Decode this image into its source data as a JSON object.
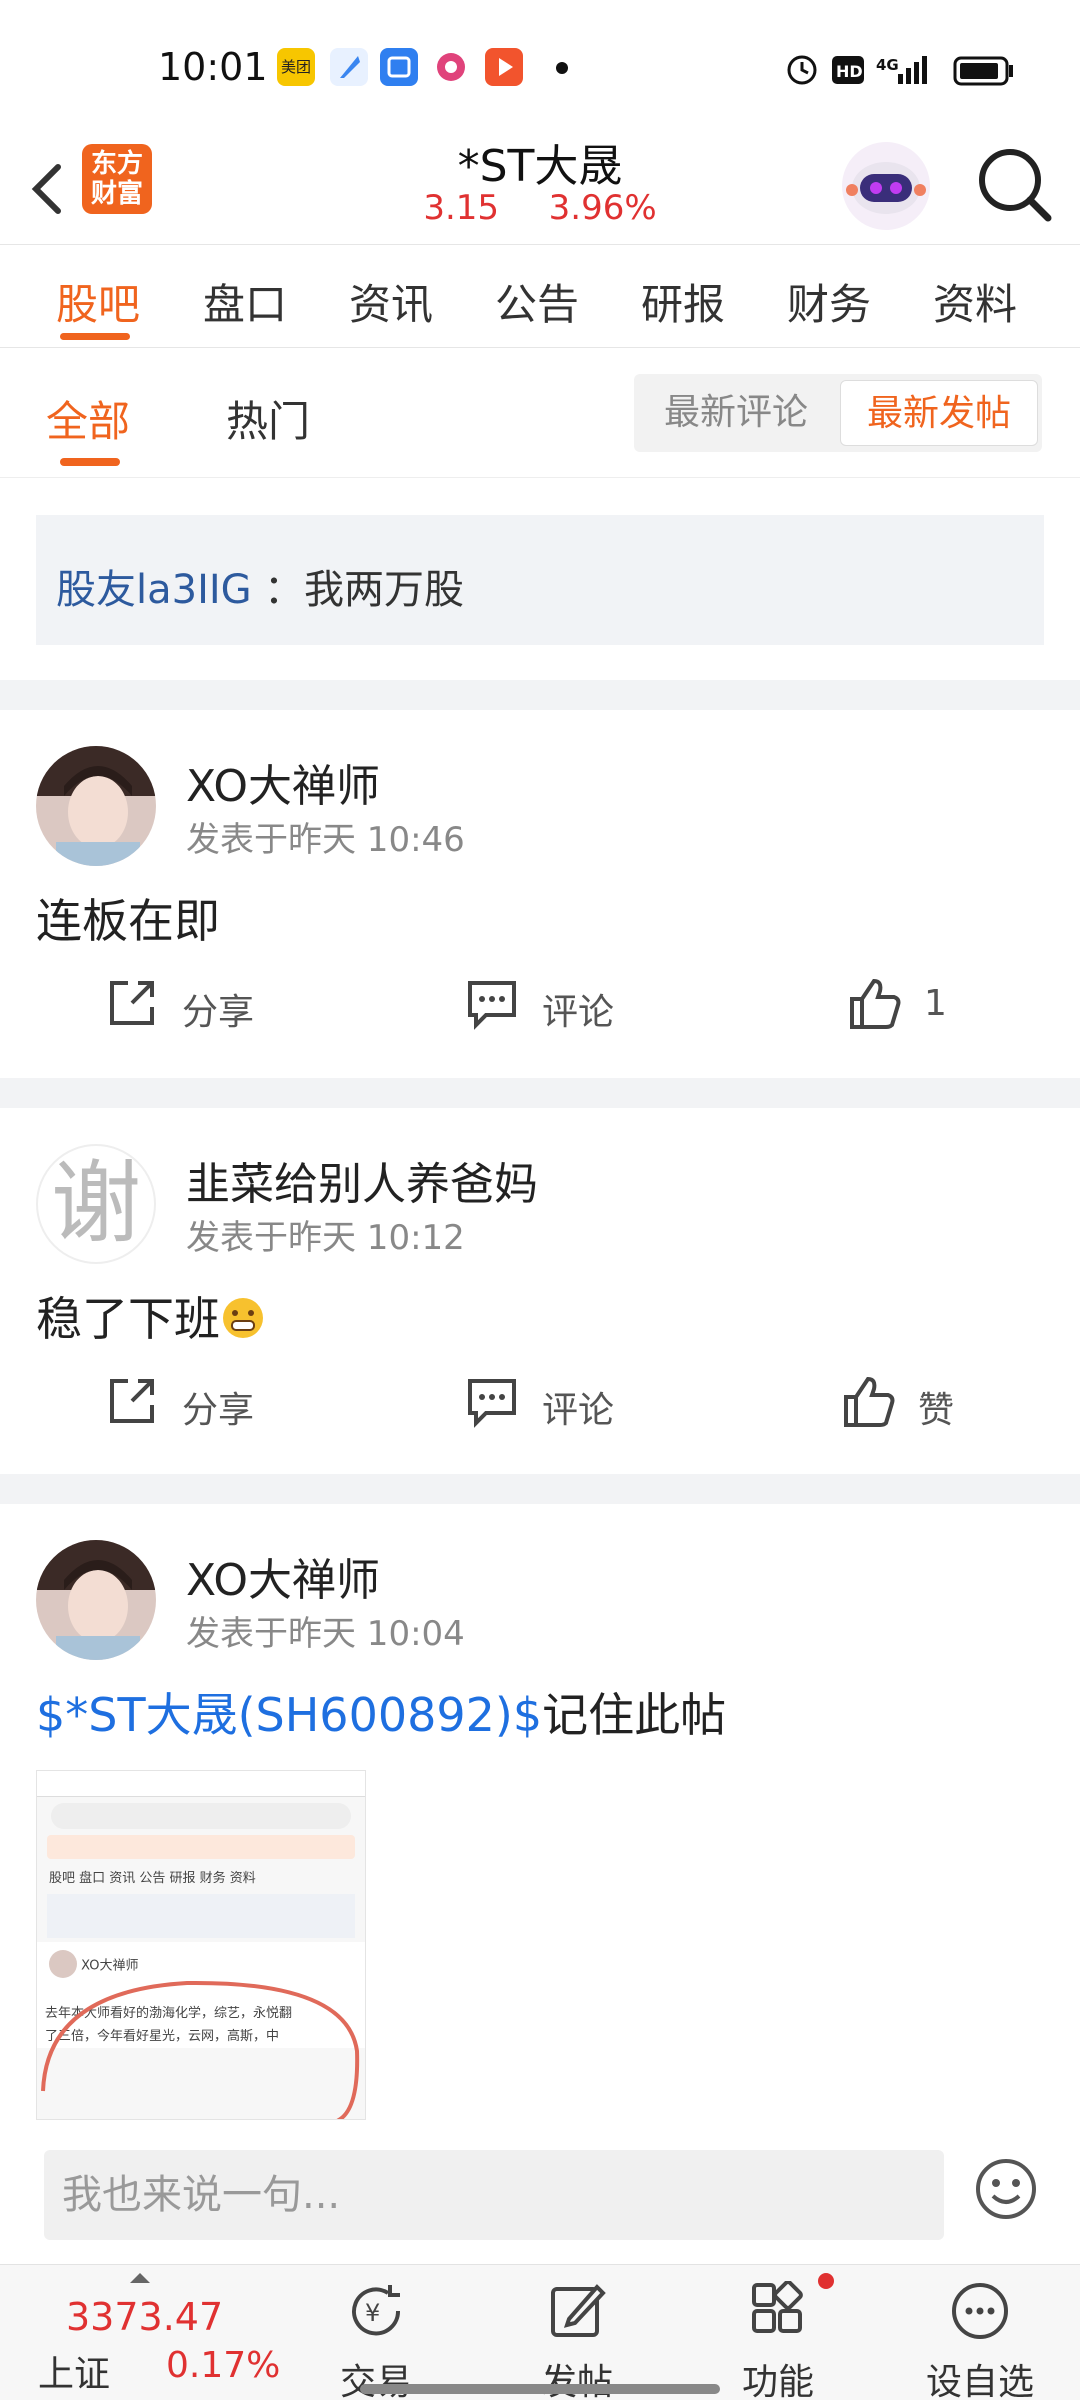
{
  "status_bar": {
    "time": "10:01",
    "app_badges": [
      "美团",
      "",
      "",
      "",
      ""
    ]
  },
  "header": {
    "back_icon": "chevron-left-icon",
    "logo_line1": "东方",
    "logo_line2": "财富",
    "stock_title": "*ST大晟",
    "price": "3.15",
    "change_pct": "3.96%",
    "robot_icon": "robot-avatar-icon",
    "search_icon": "search-icon"
  },
  "tabs": [
    "股吧",
    "盘口",
    "资讯",
    "公告",
    "研报",
    "财务",
    "资料"
  ],
  "active_tab": "股吧",
  "subtabs": [
    "全部",
    "热门"
  ],
  "sort_options": [
    "最新评论",
    "最新发帖"
  ],
  "notice": {
    "user": "股友la3IIG",
    "text": "：我两万股"
  },
  "posts": [
    {
      "user": "XO大禅师",
      "time": "发表于昨天 10:46",
      "content": "连板在即",
      "share": "分享",
      "comment": "评论",
      "like": "1"
    },
    {
      "user": "韭菜给别人养爸妈",
      "avatar_char": "谢",
      "time": "发表于昨天 10:12",
      "content": "稳了下班",
      "share": "分享",
      "comment": "评论",
      "like": "赞"
    },
    {
      "user": "XO大禅师",
      "time": "发表于昨天 10:04",
      "content_link": "$*ST大晟(SH600892)$",
      "content_rest": "记住此帖",
      "thumb": {
        "tabs": "股吧  盘口  资讯  公告  研报  财务  资料",
        "user": "XO大禅师",
        "text1": "去年本大师看好的渤海化学，综艺，永悦翻",
        "text2": "了三倍，今年看好星光，云网，高斯，中"
      }
    }
  ],
  "input_placeholder": "我也来说一句...",
  "bottom_nav": {
    "index_value": "3373.47",
    "index_name": "上证",
    "index_change": "0.17%",
    "items": [
      "交易",
      "发帖",
      "功能",
      "设自选"
    ]
  },
  "colors": {
    "accent": "#f0641e",
    "up": "#e03131",
    "link": "#1e6fe0"
  }
}
